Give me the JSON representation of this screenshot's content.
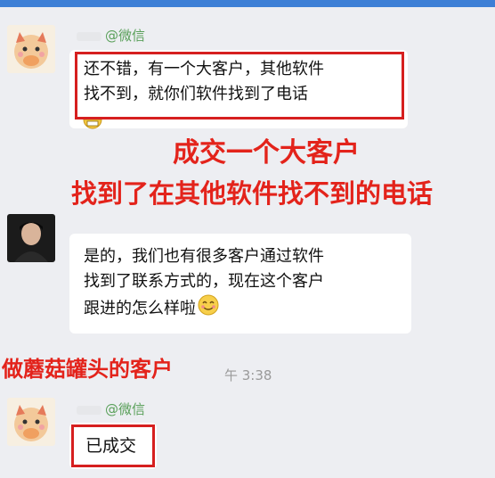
{
  "chat": {
    "msg1": {
      "sender_suffix": "@微信",
      "line1": "还不错，有一个大客户，其他软件",
      "line2": "找不到，就你们软件找到了电话"
    },
    "msg2": {
      "line1": "是的，我们也有很多客户通过软件",
      "line2": "找到了联系方式的，现在这个客户",
      "line3": "跟进的怎么样啦"
    },
    "msg3": {
      "sender_suffix": "@微信",
      "text": "已成交"
    },
    "timestamp": "午 3:38"
  },
  "annotations": {
    "headline1": "成交一个大客户",
    "headline2": "找到了在其他软件找不到的电话",
    "headline3": "做蘑菇罐头的客户"
  },
  "colors": {
    "overlay_red": "#e3231b",
    "box_red": "#d61f1f",
    "sender_green": "#5aa05a",
    "chat_bg": "#edeef2"
  },
  "icons": [
    "cartoon-avatar",
    "person-avatar",
    "smile-emoji",
    "grin-emoji"
  ]
}
